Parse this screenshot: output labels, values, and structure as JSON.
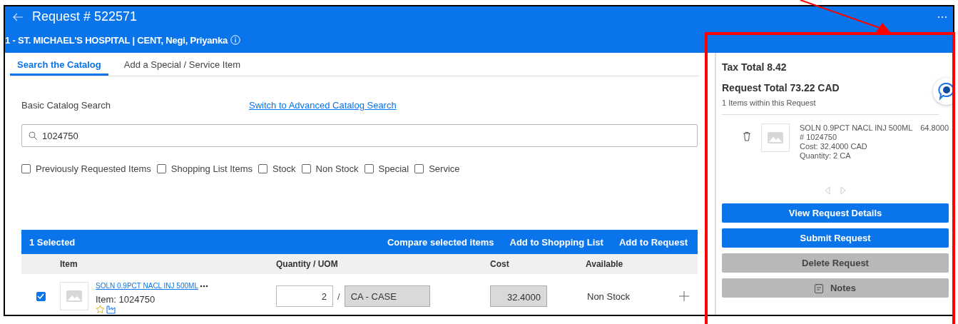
{
  "header": {
    "title": "Request # 522571",
    "subtitle": "1 - ST. MICHAEL'S HOSPITAL | CENT, Negi, Priyanka"
  },
  "tabs": [
    {
      "label": "Search the Catalog",
      "selected": true
    },
    {
      "label": "Add a Special / Service Item",
      "selected": false
    }
  ],
  "search": {
    "label": "Basic Catalog Search",
    "advanced_link": "Switch to Advanced Catalog Search",
    "value": "1024750"
  },
  "filters": [
    {
      "label": "Previously Requested Items",
      "checked": false
    },
    {
      "label": "Shopping List Items",
      "checked": false
    },
    {
      "label": "Stock",
      "checked": false
    },
    {
      "label": "Non Stock",
      "checked": false
    },
    {
      "label": "Special",
      "checked": false
    },
    {
      "label": "Service",
      "checked": false
    }
  ],
  "results": {
    "selected_count": "1 Selected",
    "actions": [
      "Compare selected items",
      "Add to Shopping List",
      "Add to Request"
    ],
    "columns": [
      "Item",
      "Quantity / UOM",
      "Cost",
      "Available"
    ],
    "rows": [
      {
        "selected": true,
        "name": "SOLN 0.9PCT NACL INJ 500ML",
        "item": "Item: 1024750",
        "quantity": "2",
        "separator": "/",
        "uom": "CA - CASE",
        "cost": "32.4000",
        "available": "Non Stock"
      }
    ]
  },
  "summary": {
    "tax_total": "Tax Total 8.42",
    "request_total": "Request Total 73.22 CAD",
    "items_count": "1 Items within this Request",
    "items": [
      {
        "name": "SOLN 0.9PCT NACL INJ 500ML",
        "amount": "64.8000",
        "number": "# 1024750",
        "cost": "Cost: 32.4000 CAD",
        "quantity": "Quantity: 2 CA"
      }
    ],
    "buttons": [
      {
        "label": "View Request Details",
        "kind": "primary"
      },
      {
        "label": "Submit Request",
        "kind": "primary"
      },
      {
        "label": "Delete Request",
        "kind": "secondary"
      },
      {
        "label": "Notes",
        "kind": "notes"
      }
    ]
  }
}
